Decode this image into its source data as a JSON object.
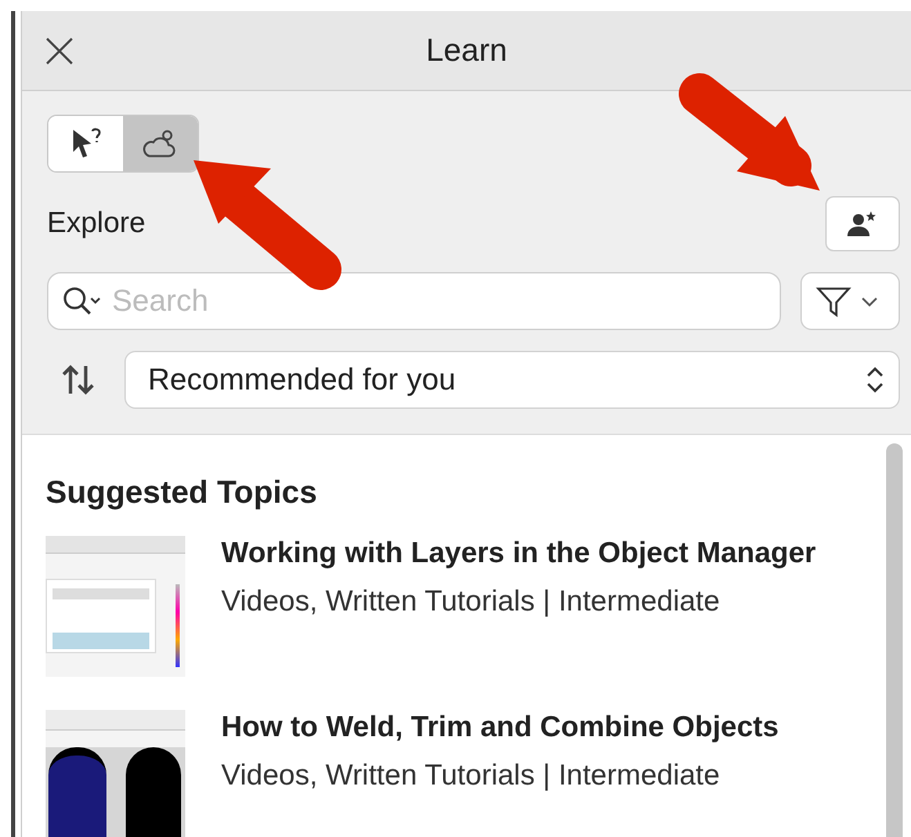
{
  "window": {
    "title": "Learn"
  },
  "modes": [
    {
      "kind": "help",
      "selected": false
    },
    {
      "kind": "explore",
      "selected": true
    }
  ],
  "section_label": "Explore",
  "search": {
    "placeholder": "Search"
  },
  "sort": {
    "value": "Recommended for you"
  },
  "heading": "Suggested Topics",
  "topics": [
    {
      "title": "Working with Layers in the Object Manager",
      "meta": "Videos, Written Tutorials | Intermediate",
      "kind": "document"
    },
    {
      "title": "How to Weld, Trim and Combine Objects",
      "meta": "Videos, Written Tutorials | Intermediate",
      "kind": "castles"
    }
  ]
}
